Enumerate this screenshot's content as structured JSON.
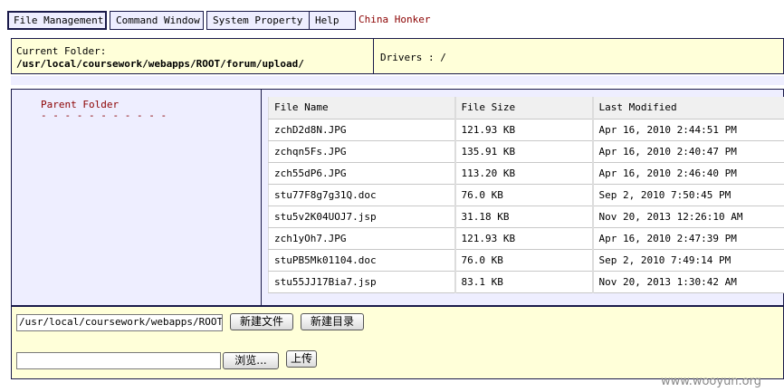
{
  "nav": {
    "tabs": [
      "File Management",
      "Command Window",
      "System Property",
      "Help"
    ],
    "brand_link": "China Honker",
    "brand_color": "#8b0000"
  },
  "path_bar": {
    "label": "Current Folder:",
    "value": "/usr/local/coursework/webapps/ROOT/forum/upload/",
    "drivers_label": "Drivers : /"
  },
  "left_pane": {
    "parent_folder": "Parent Folder",
    "dashes": "- - - - - - - - - - -"
  },
  "files": {
    "columns": [
      "File Name",
      "File Size",
      "Last Modified"
    ],
    "rows": [
      [
        "zchD2d8N.JPG",
        "121.93 KB",
        "Apr 16, 2010 2:44:51 PM"
      ],
      [
        "zchqn5Fs.JPG",
        "135.91 KB",
        "Apr 16, 2010 2:40:47 PM"
      ],
      [
        "zch55dP6.JPG",
        "113.20 KB",
        "Apr 16, 2010 2:46:40 PM"
      ],
      [
        "stu77F8g7g31Q.doc",
        "76.0 KB",
        "Sep 2, 2010 7:50:45 PM"
      ],
      [
        "stu5v2K04UOJ7.jsp",
        "31.18 KB",
        "Nov 20, 2013 12:26:10 AM"
      ],
      [
        "zch1yOh7.JPG",
        "121.93 KB",
        "Apr 16, 2010 2:47:39 PM"
      ],
      [
        "stuPB5Mk01104.doc",
        "76.0 KB",
        "Sep 2, 2010 7:49:14 PM"
      ],
      [
        "stu55JJ17Bia7.jsp",
        "83.1 KB",
        "Nov 20, 2013 1:30:42 AM"
      ]
    ]
  },
  "bottom": {
    "path_input_value": "/usr/local/coursework/webapps/ROOT/forum/upload/",
    "new_file_button": "新建文件",
    "new_dir_button": "新建目录",
    "upload_input_value": "",
    "browse_button": "浏览...",
    "upload_button": "上传"
  },
  "watermark": "www.wooyun.org"
}
